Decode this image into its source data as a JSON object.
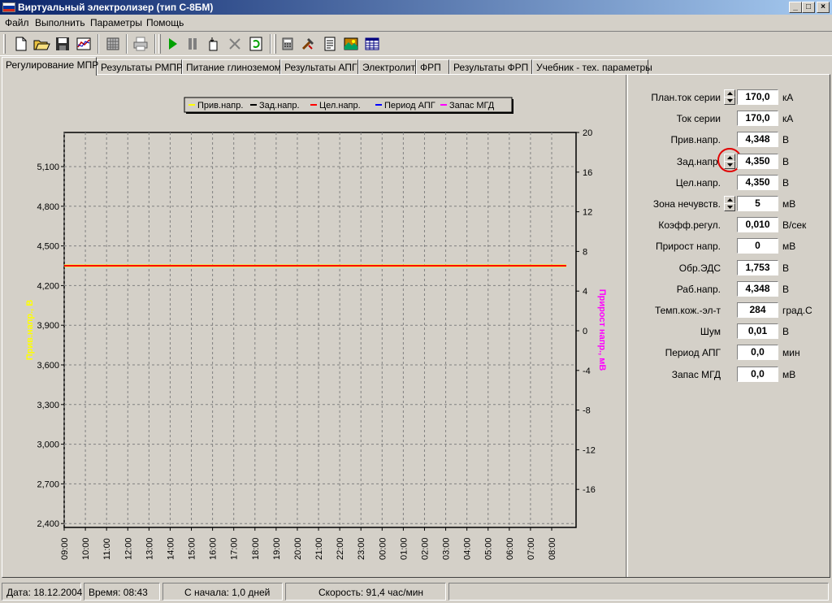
{
  "window": {
    "title": "Виртуальный электролизер (тип С-8БМ)",
    "controls": [
      "_",
      "□",
      "×"
    ]
  },
  "menu": [
    "Файл",
    "Выполнить",
    "Параметры",
    "Помощь"
  ],
  "toolbar": {
    "icons": [
      "new-file-icon",
      "open-folder-icon",
      "save-icon",
      "chart-icon",
      "grid-icon",
      "print-icon",
      "play-icon",
      "pause-icon",
      "step-icon",
      "stop-icon",
      "refresh-icon",
      "calculator-icon",
      "tools-icon",
      "document-icon",
      "landscape-icon",
      "table-icon"
    ]
  },
  "tabs": [
    "Регулирование МПР",
    "Результаты РМПР",
    "Питание глиноземом",
    "Результаты АПГ",
    "Электролит",
    "ФРП",
    "Результаты ФРП",
    "Учебник - тех. параметры"
  ],
  "active_tab": "Регулирование МПР",
  "chart_data": {
    "type": "line",
    "legend": [
      "Прив.напр.",
      "Зад.напр.",
      "Цел.напр.",
      "Период АПГ",
      "Запас МГД"
    ],
    "legend_colors": [
      "#ffff00",
      "#000000",
      "#ff0000",
      "#0000ff",
      "#ff00ff"
    ],
    "ylabel_left": "Прив.напр., В",
    "ylabel_right": "Прирост напр., мВ",
    "ylabel_left_color": "#ffff00",
    "ylabel_right_color": "#ff00ff",
    "y_left_ticks": [
      "5,100",
      "4,800",
      "4,500",
      "4,200",
      "3,900",
      "3,600",
      "3,300",
      "3,000",
      "2,700",
      "2,400"
    ],
    "y_right_ticks": [
      "20",
      "16",
      "12",
      "8",
      "4",
      "0",
      "-4",
      "-8",
      "-12",
      "-16"
    ],
    "x_ticks": [
      "09:00",
      "10:00",
      "11:00",
      "12:00",
      "13:00",
      "14:00",
      "15:00",
      "16:00",
      "17:00",
      "18:00",
      "19:00",
      "20:00",
      "21:00",
      "22:00",
      "23:00",
      "00:00",
      "01:00",
      "02:00",
      "03:00",
      "04:00",
      "05:00",
      "06:00",
      "07:00",
      "08:00"
    ],
    "ylim_left": [
      2.35,
      5.35
    ],
    "series": [
      {
        "name": "Прив.напр.",
        "color": "#ffff00",
        "values": [
          4.35,
          4.35
        ]
      },
      {
        "name": "Цел.напр.",
        "color": "#ff0000",
        "values": [
          4.35,
          4.35
        ]
      }
    ],
    "grid": true
  },
  "params": [
    {
      "label": "План.ток серии",
      "value": "170,0",
      "unit": "кА",
      "spinner": true
    },
    {
      "label": "Ток серии",
      "value": "170,0",
      "unit": "кА",
      "spinner": false
    },
    {
      "label": "Прив.напр.",
      "value": "4,348",
      "unit": "В",
      "spinner": false
    },
    {
      "label": "Зад.напр.",
      "value": "4,350",
      "unit": "В",
      "spinner": true,
      "highlight": true
    },
    {
      "label": "Цел.напр.",
      "value": "4,350",
      "unit": "В",
      "spinner": false
    },
    {
      "label": "Зона нечувств.",
      "value": "5",
      "unit": "мВ",
      "spinner": true
    },
    {
      "label": "Коэфф.регул.",
      "value": "0,010",
      "unit": "В/сек",
      "spinner": false
    },
    {
      "label": "Прирост напр.",
      "value": "0",
      "unit": "мВ",
      "spinner": false
    },
    {
      "label": "Обр.ЭДС",
      "value": "1,753",
      "unit": "В",
      "spinner": false
    },
    {
      "label": "Раб.напр.",
      "value": "4,348",
      "unit": "В",
      "spinner": false
    },
    {
      "label": "Темп.кож.-эл-т",
      "value": "284",
      "unit": "град.С",
      "spinner": false
    },
    {
      "label": "Шум",
      "value": "0,01",
      "unit": "В",
      "spinner": false
    },
    {
      "label": "Период АПГ",
      "value": "0,0",
      "unit": "мин",
      "spinner": false
    },
    {
      "label": "Запас МГД",
      "value": "0,0",
      "unit": "мВ",
      "spinner": false
    }
  ],
  "status": {
    "date": "Дата: 18.12.2004",
    "time": "Время: 08:43",
    "since": "С начала: 1,0 дней",
    "speed": "Скорость: 91,4 час/мин"
  }
}
